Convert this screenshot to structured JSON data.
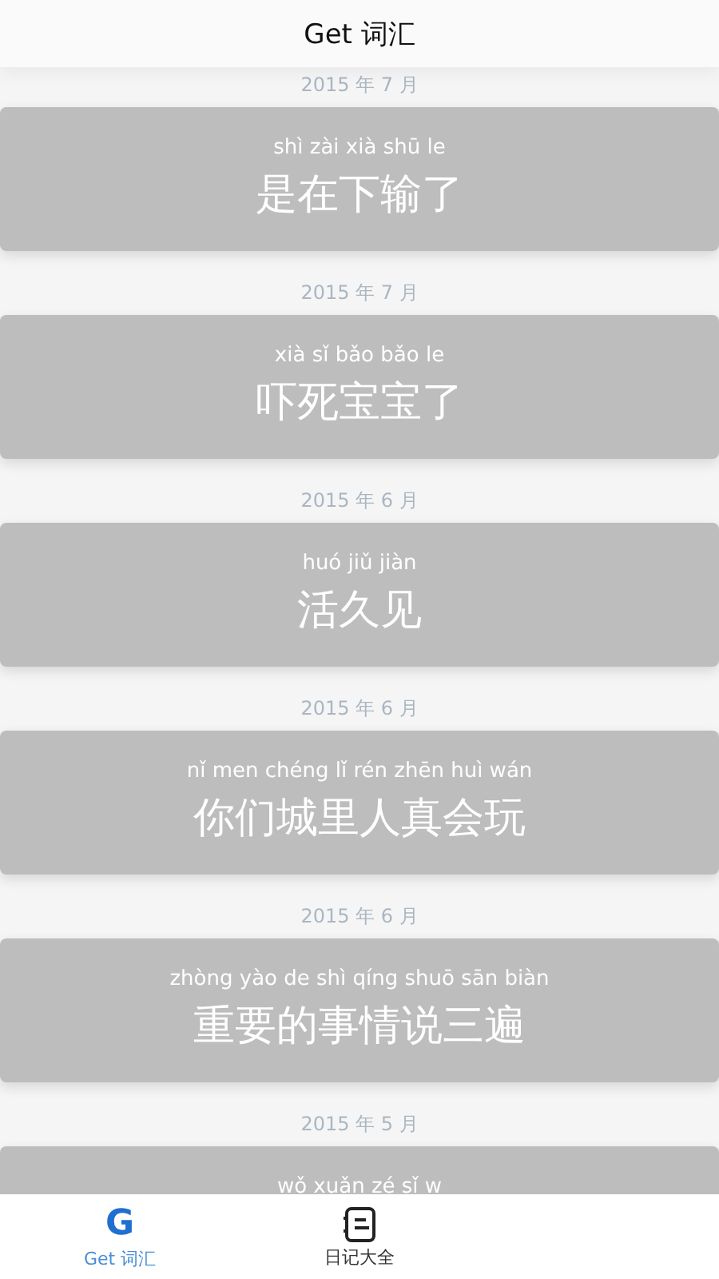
{
  "header": {
    "title": "Get 词汇"
  },
  "entries": [
    {
      "date": "2015 年 7 月",
      "pinyin": "shì zài xià shū le",
      "phrase": "是在下输了"
    },
    {
      "date": "2015 年 7 月",
      "pinyin": "xià sǐ bǎo bǎo le",
      "phrase": "吓死宝宝了"
    },
    {
      "date": "2015 年 6 月",
      "pinyin": "huó jiǔ jiàn",
      "phrase": "活久见"
    },
    {
      "date": "2015 年 6 月",
      "pinyin": "nǐ men chéng lǐ rén zhēn huì wán",
      "phrase": "你们城里人真会玩"
    },
    {
      "date": "2015 年 6 月",
      "pinyin": "zhòng yào de shì qíng shuō sān biàn",
      "phrase": "重要的事情说三遍"
    },
    {
      "date": "2015 年 5 月",
      "pinyin": "wǒ xuǎn zé sǐ w"
    }
  ],
  "tabs": [
    {
      "kind": "letter",
      "glyph": "G",
      "label": "Get 词汇",
      "selected": true
    },
    {
      "kind": "notebook",
      "label": "日记大全",
      "selected": false
    }
  ]
}
